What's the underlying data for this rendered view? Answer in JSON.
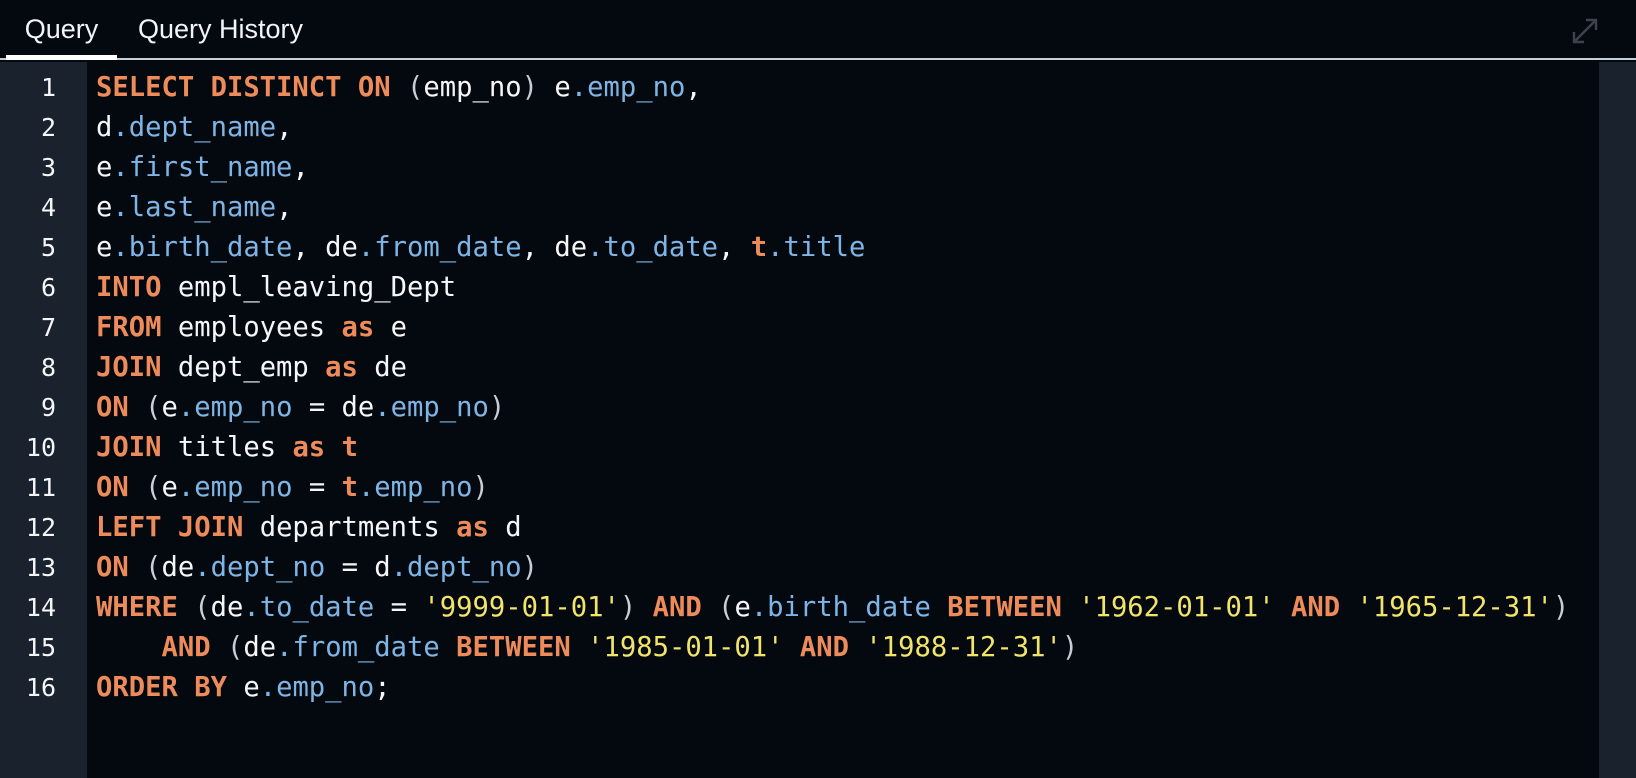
{
  "tabs": {
    "query_label": "Query",
    "history_label": "Query History"
  },
  "icons": {
    "expand": "expand-icon"
  },
  "colors": {
    "keyword": "#ee8b5b",
    "column": "#7fb5e6",
    "string": "#f2e46a",
    "text": "#f5f6f8",
    "background": "#04090f",
    "gutter": "#1a232d"
  },
  "editor": {
    "lines": [
      {
        "num": "1",
        "tokens": [
          {
            "t": "kw",
            "v": "SELECT DISTINCT ON"
          },
          {
            "t": "id",
            "v": " "
          },
          {
            "t": "pun",
            "v": "("
          },
          {
            "t": "id",
            "v": "emp_no"
          },
          {
            "t": "pun",
            "v": ")"
          },
          {
            "t": "id",
            "v": " e"
          },
          {
            "t": "col",
            "v": ".emp_no"
          },
          {
            "t": "id",
            "v": ","
          }
        ]
      },
      {
        "num": "2",
        "tokens": [
          {
            "t": "id",
            "v": "d"
          },
          {
            "t": "col",
            "v": ".dept_name"
          },
          {
            "t": "id",
            "v": ","
          }
        ]
      },
      {
        "num": "3",
        "tokens": [
          {
            "t": "id",
            "v": "e"
          },
          {
            "t": "col",
            "v": ".first_name"
          },
          {
            "t": "id",
            "v": ","
          }
        ]
      },
      {
        "num": "4",
        "tokens": [
          {
            "t": "id",
            "v": "e"
          },
          {
            "t": "col",
            "v": ".last_name"
          },
          {
            "t": "id",
            "v": ","
          }
        ]
      },
      {
        "num": "5",
        "tokens": [
          {
            "t": "id",
            "v": "e"
          },
          {
            "t": "col",
            "v": ".birth_date"
          },
          {
            "t": "id",
            "v": ", de"
          },
          {
            "t": "col",
            "v": ".from_date"
          },
          {
            "t": "id",
            "v": ", de"
          },
          {
            "t": "col",
            "v": ".to_date"
          },
          {
            "t": "id",
            "v": ", "
          },
          {
            "t": "kw",
            "v": "t"
          },
          {
            "t": "col",
            "v": ".title"
          }
        ]
      },
      {
        "num": "6",
        "tokens": [
          {
            "t": "kw",
            "v": "INTO"
          },
          {
            "t": "id",
            "v": " empl_leaving_Dept"
          }
        ]
      },
      {
        "num": "7",
        "tokens": [
          {
            "t": "kw",
            "v": "FROM"
          },
          {
            "t": "id",
            "v": " employees "
          },
          {
            "t": "kw",
            "v": "as"
          },
          {
            "t": "id",
            "v": " e"
          }
        ]
      },
      {
        "num": "8",
        "tokens": [
          {
            "t": "kw",
            "v": "JOIN"
          },
          {
            "t": "id",
            "v": " dept_emp "
          },
          {
            "t": "kw",
            "v": "as"
          },
          {
            "t": "id",
            "v": " de"
          }
        ]
      },
      {
        "num": "9",
        "tokens": [
          {
            "t": "kw",
            "v": "ON"
          },
          {
            "t": "id",
            "v": " "
          },
          {
            "t": "pun",
            "v": "("
          },
          {
            "t": "id",
            "v": "e"
          },
          {
            "t": "col",
            "v": ".emp_no"
          },
          {
            "t": "id",
            "v": " = de"
          },
          {
            "t": "col",
            "v": ".emp_no"
          },
          {
            "t": "pun",
            "v": ")"
          }
        ]
      },
      {
        "num": "10",
        "tokens": [
          {
            "t": "kw",
            "v": "JOIN"
          },
          {
            "t": "id",
            "v": " titles "
          },
          {
            "t": "kw",
            "v": "as"
          },
          {
            "t": "id",
            "v": " "
          },
          {
            "t": "kw",
            "v": "t"
          }
        ]
      },
      {
        "num": "11",
        "tokens": [
          {
            "t": "kw",
            "v": "ON"
          },
          {
            "t": "id",
            "v": " "
          },
          {
            "t": "pun",
            "v": "("
          },
          {
            "t": "id",
            "v": "e"
          },
          {
            "t": "col",
            "v": ".emp_no"
          },
          {
            "t": "id",
            "v": " = "
          },
          {
            "t": "kw",
            "v": "t"
          },
          {
            "t": "col",
            "v": ".emp_no"
          },
          {
            "t": "pun",
            "v": ")"
          }
        ]
      },
      {
        "num": "12",
        "tokens": [
          {
            "t": "kw",
            "v": "LEFT JOIN"
          },
          {
            "t": "id",
            "v": " departments "
          },
          {
            "t": "kw",
            "v": "as"
          },
          {
            "t": "id",
            "v": " d"
          }
        ]
      },
      {
        "num": "13",
        "tokens": [
          {
            "t": "kw",
            "v": "ON"
          },
          {
            "t": "id",
            "v": " "
          },
          {
            "t": "pun",
            "v": "("
          },
          {
            "t": "id",
            "v": "de"
          },
          {
            "t": "col",
            "v": ".dept_no"
          },
          {
            "t": "id",
            "v": " = d"
          },
          {
            "t": "col",
            "v": ".dept_no"
          },
          {
            "t": "pun",
            "v": ")"
          }
        ]
      },
      {
        "num": "14",
        "tokens": [
          {
            "t": "kw",
            "v": "WHERE"
          },
          {
            "t": "id",
            "v": " "
          },
          {
            "t": "pun",
            "v": "("
          },
          {
            "t": "id",
            "v": "de"
          },
          {
            "t": "col",
            "v": ".to_date"
          },
          {
            "t": "id",
            "v": " = "
          },
          {
            "t": "str",
            "v": "'9999-01-01'"
          },
          {
            "t": "pun",
            "v": ")"
          },
          {
            "t": "id",
            "v": " "
          },
          {
            "t": "kw",
            "v": "AND"
          },
          {
            "t": "id",
            "v": " "
          },
          {
            "t": "pun",
            "v": "("
          },
          {
            "t": "id",
            "v": "e"
          },
          {
            "t": "col",
            "v": ".birth_date"
          },
          {
            "t": "id",
            "v": " "
          },
          {
            "t": "kw",
            "v": "BETWEEN"
          },
          {
            "t": "id",
            "v": " "
          },
          {
            "t": "str",
            "v": "'1962-01-01'"
          },
          {
            "t": "id",
            "v": " "
          },
          {
            "t": "kw",
            "v": "AND"
          },
          {
            "t": "id",
            "v": " "
          },
          {
            "t": "str",
            "v": "'1965-12-31'"
          },
          {
            "t": "pun",
            "v": ")"
          }
        ]
      },
      {
        "num": "15",
        "tokens": [
          {
            "t": "id",
            "v": "    "
          },
          {
            "t": "kw",
            "v": "AND"
          },
          {
            "t": "id",
            "v": " "
          },
          {
            "t": "pun",
            "v": "("
          },
          {
            "t": "id",
            "v": "de"
          },
          {
            "t": "col",
            "v": ".from_date"
          },
          {
            "t": "id",
            "v": " "
          },
          {
            "t": "kw",
            "v": "BETWEEN"
          },
          {
            "t": "id",
            "v": " "
          },
          {
            "t": "str",
            "v": "'1985-01-01'"
          },
          {
            "t": "id",
            "v": " "
          },
          {
            "t": "kw",
            "v": "AND"
          },
          {
            "t": "id",
            "v": " "
          },
          {
            "t": "str",
            "v": "'1988-12-31'"
          },
          {
            "t": "pun",
            "v": ")"
          }
        ]
      },
      {
        "num": "16",
        "tokens": [
          {
            "t": "kw",
            "v": "ORDER BY"
          },
          {
            "t": "id",
            "v": " e"
          },
          {
            "t": "col",
            "v": ".emp_no"
          },
          {
            "t": "id",
            "v": ";"
          }
        ]
      }
    ]
  }
}
